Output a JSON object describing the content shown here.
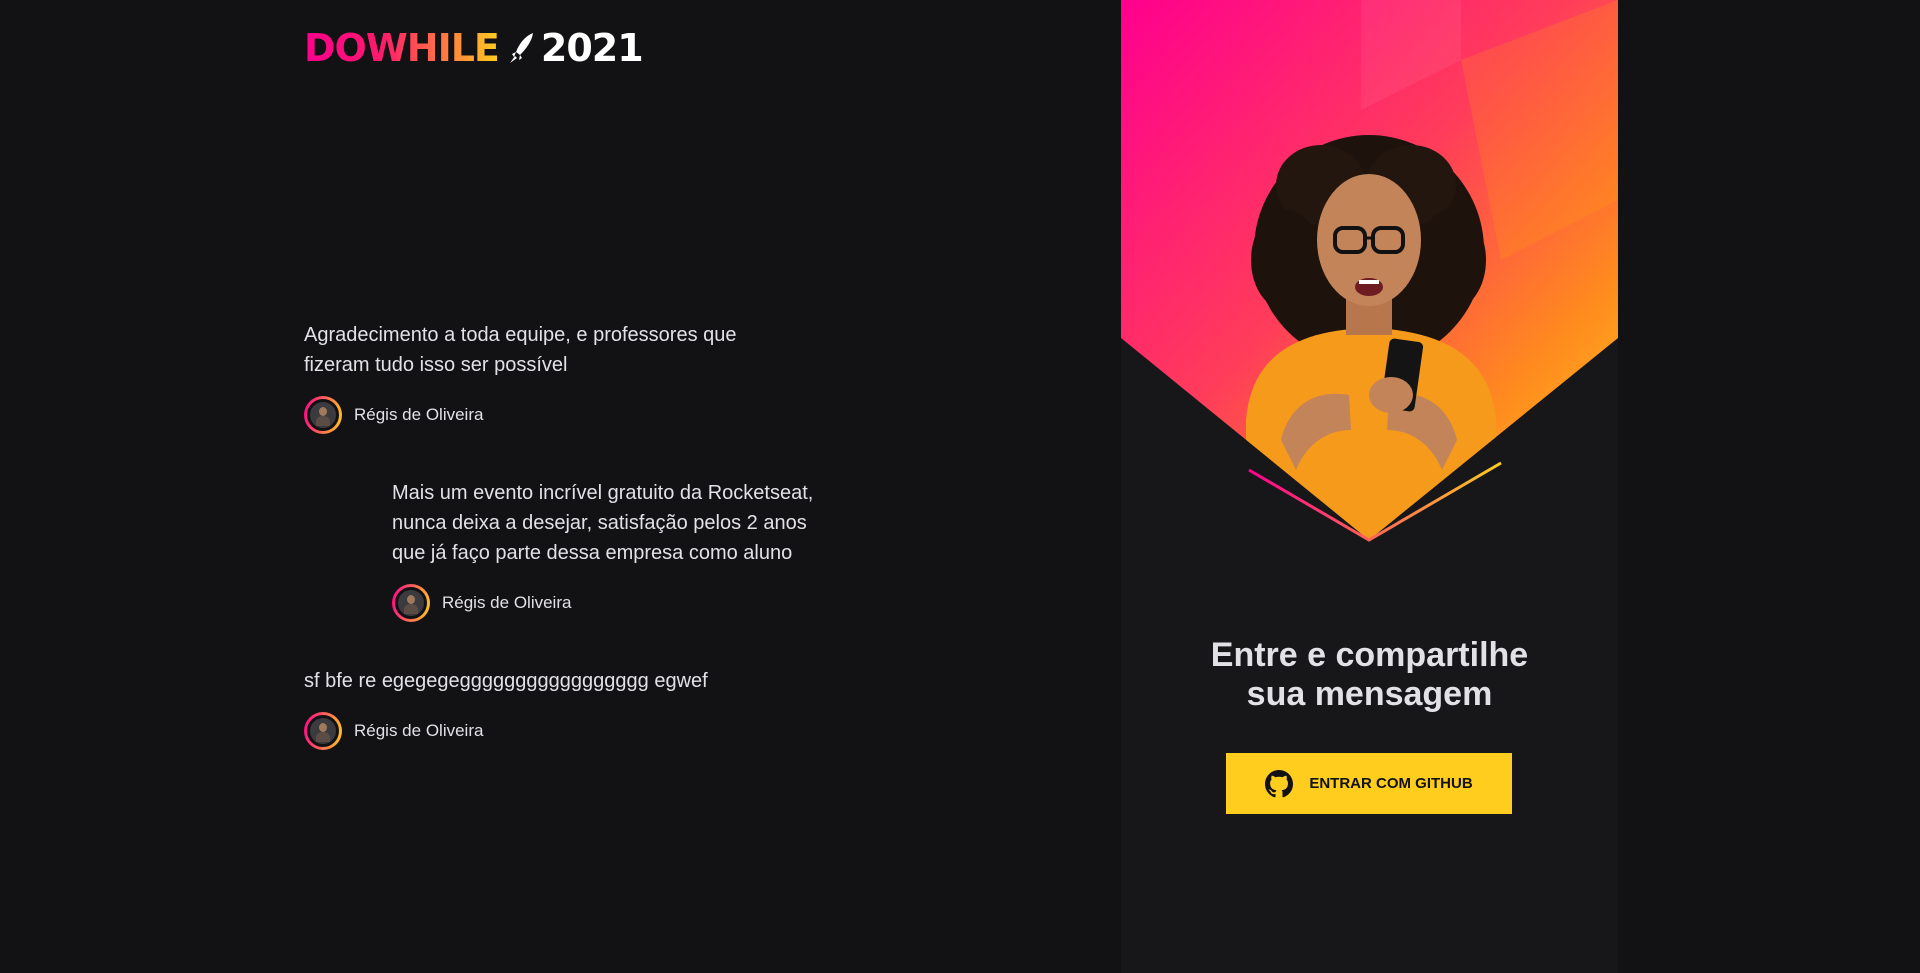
{
  "header": {
    "logo_brand": "DOWHILE",
    "logo_year": "2021"
  },
  "messages": [
    {
      "content": "Agradecimento a toda equipe, e professores que\nfizeram tudo isso ser possível",
      "user_name": "Régis de Oliveira"
    },
    {
      "content": "Mais um evento incrível gratuito da Rocketseat,\nnunca deixa a desejar, satisfação pelos 2 anos\nque já faço parte dessa empresa como aluno",
      "user_name": "Régis de Oliveira"
    },
    {
      "content": "sf bfe re egegegeggggggggggggggggg egwef",
      "user_name": "Régis de Oliveira"
    }
  ],
  "login": {
    "title_line1": "Entre e compartilhe",
    "title_line2": "sua mensagem",
    "button_label": "Entrar com GitHub"
  },
  "colors": {
    "background": "#121214",
    "panel": "#17171a",
    "pink": "#ff008e",
    "yellow": "#ffcd1e",
    "text": "#e1e1e6"
  },
  "icons": {
    "logo_rocket": "rocket-icon",
    "github": "github-icon",
    "avatar": "user-avatar"
  }
}
